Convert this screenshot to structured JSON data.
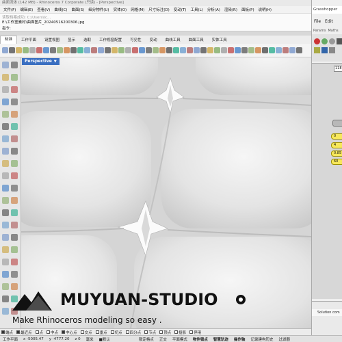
{
  "window": {
    "title": "曲面流体 (142 MB) - Rhinoceros 7 Corporate (只读) - [Perspective]"
  },
  "menu": [
    "文件(F)",
    "编辑(E)",
    "查看(V)",
    "曲线(C)",
    "曲面(S)",
    "细分物件(U)",
    "实体(O)",
    "网格(M)",
    "尺寸标注(D)",
    "变动(T)",
    "工具(L)",
    "分析(A)",
    "渲染(R)",
    "面板(P)",
    "说明(H)"
  ],
  "command": {
    "history": "读取档案成功: C:\\Users\\Ic...",
    "file_path": "E:\\工作室素材\\曲面图片_20240516200306.jpg",
    "prompt": "指令:"
  },
  "toolbar_tabs": [
    "标准",
    "工作平面",
    "设置视图",
    "显示",
    "选取",
    "工作视窗配置",
    "可见性",
    "变动",
    "曲线工具",
    "曲面工具",
    "实体工具"
  ],
  "active_tab_index": 0,
  "viewport": {
    "name": "Perspective"
  },
  "watermark": {
    "brand": "MUYUAN-STUDIO",
    "tagline": "Make Rhinoceros modeling so easy ."
  },
  "grasshopper": {
    "title": "Grasshopper",
    "menu": [
      "File",
      "Edit"
    ],
    "tabs": [
      "Params",
      "Maths"
    ],
    "input_value": "118",
    "sliders": [
      "0",
      "4",
      "0.85",
      "60"
    ],
    "solution_label": "Solution com"
  },
  "osnaps": [
    {
      "label": "端点",
      "on": true
    },
    {
      "label": "最近点",
      "on": true
    },
    {
      "label": "点",
      "on": false
    },
    {
      "label": "中点",
      "on": false
    },
    {
      "label": "中心点",
      "on": true
    },
    {
      "label": "交点",
      "on": false
    },
    {
      "label": "垂点",
      "on": false
    },
    {
      "label": "切点",
      "on": false
    },
    {
      "label": "四分点",
      "on": false
    },
    {
      "label": "节点",
      "on": false
    },
    {
      "label": "顶点",
      "on": false
    },
    {
      "label": "投影",
      "on": false
    },
    {
      "label": "停用",
      "on": false
    }
  ],
  "status": {
    "cplane": "工作平面",
    "x": "x -5005.47",
    "y": "y -4777.20",
    "z": "z 0",
    "units": "毫米",
    "layer": "■默认",
    "items": [
      "锁定格点",
      "正交",
      "平面模式",
      "物件锁点",
      "智慧轨迹",
      "操作轴",
      "记录建构历史",
      "过滤器"
    ]
  },
  "colors": {
    "viewport_label_bg": "#3a6fc1",
    "slider_yellow": "#f7e85a",
    "surface_base": "#e9e9e9"
  }
}
